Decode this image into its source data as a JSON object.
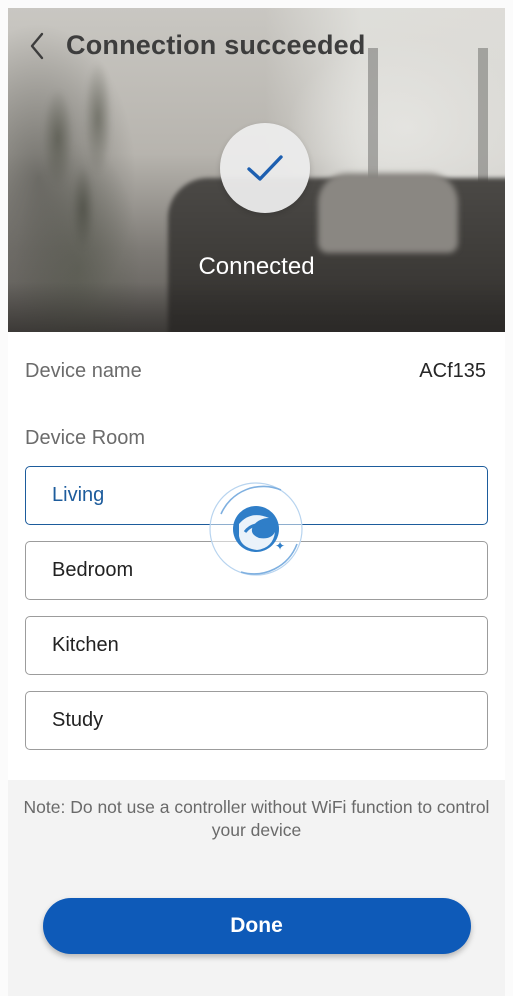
{
  "header": {
    "title": "Connection succeeded",
    "status": "Connected",
    "back_icon": "chevron-left-icon",
    "status_icon": "checkmark-icon"
  },
  "device": {
    "name_label": "Device name",
    "name_value": "ACf135",
    "room_label": "Device Room",
    "rooms": [
      {
        "label": "Living",
        "selected": true
      },
      {
        "label": "Bedroom",
        "selected": false
      },
      {
        "label": "Kitchen",
        "selected": false
      },
      {
        "label": "Study",
        "selected": false
      }
    ]
  },
  "note": "Note: Do not use a controller without WiFi function to control your device",
  "actions": {
    "done_label": "Done"
  },
  "colors": {
    "accent": "#0e5ab8",
    "selected_border": "#1d5c9c",
    "title_text": "#3d3d3d"
  }
}
